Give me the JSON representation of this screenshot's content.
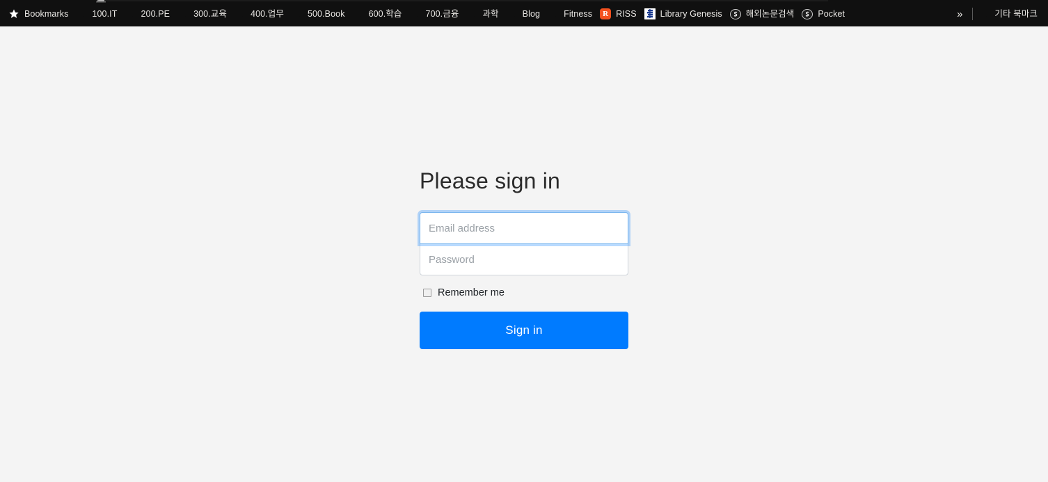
{
  "browser": {
    "bookmarks_bar": {
      "items": [
        {
          "label": "Bookmarks",
          "icon": "star-icon"
        },
        {
          "label": "100.IT",
          "icon": "folder-icon"
        },
        {
          "label": "200.PE",
          "icon": "folder-icon"
        },
        {
          "label": "300.교육",
          "icon": "folder-icon"
        },
        {
          "label": "400.업무",
          "icon": "folder-icon"
        },
        {
          "label": "500.Book",
          "icon": "folder-icon"
        },
        {
          "label": "600.학습",
          "icon": "folder-icon"
        },
        {
          "label": "700.금융",
          "icon": "folder-icon"
        },
        {
          "label": "과학",
          "icon": "folder-icon"
        },
        {
          "label": "Blog",
          "icon": "folder-icon"
        },
        {
          "label": "Fitness",
          "icon": "folder-icon"
        },
        {
          "label": "RISS",
          "icon": "riss-icon"
        },
        {
          "label": "Library Genesis",
          "icon": "library-genesis-icon"
        },
        {
          "label": "해외논문검색",
          "icon": "globe-icon"
        },
        {
          "label": "Pocket",
          "icon": "globe-icon"
        }
      ],
      "overflow_label": "»",
      "other_bookmarks": {
        "label": "기타 북마크",
        "icon": "folder-icon"
      },
      "riss_badge_letter": "R"
    }
  },
  "main": {
    "title": "Please sign in",
    "email": {
      "placeholder": "Email address",
      "value": ""
    },
    "password": {
      "placeholder": "Password",
      "value": ""
    },
    "remember": {
      "label": "Remember me",
      "checked": false
    },
    "submit_label": "Sign in"
  },
  "colors": {
    "accent": "#007bff",
    "focus_border": "#7ab5ee",
    "page_background": "#f4f4f4",
    "chrome_background": "#101010",
    "folder_icon": "#f6d26a",
    "riss_icon": "#f4511e"
  }
}
